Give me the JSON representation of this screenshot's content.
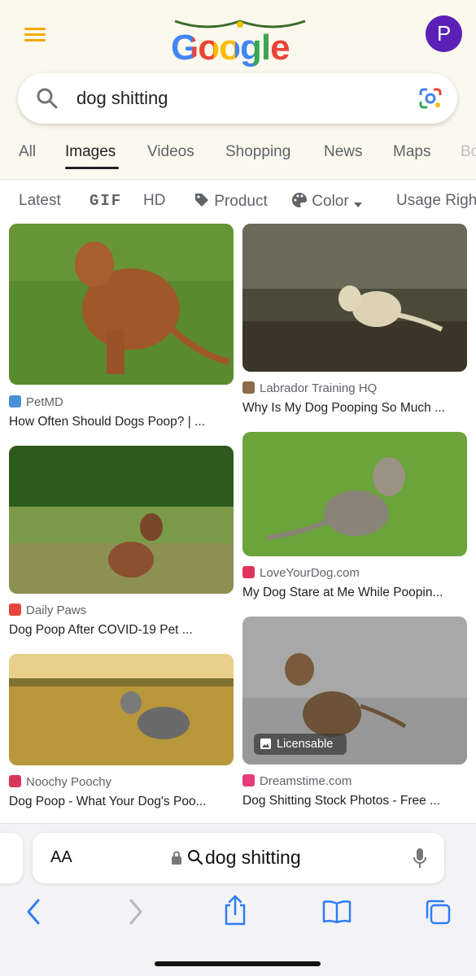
{
  "header": {
    "logo_text": "Google",
    "avatar_letter": "P",
    "colors": {
      "menu": "#f2a900",
      "avatar": "#5b21b6"
    }
  },
  "search": {
    "query": "dog shitting"
  },
  "tabs": [
    {
      "label": "All"
    },
    {
      "label": "Images",
      "active": true
    },
    {
      "label": "Videos"
    },
    {
      "label": "Shopping"
    },
    {
      "label": "News"
    },
    {
      "label": "Maps"
    },
    {
      "label": "Bo"
    }
  ],
  "chips": [
    {
      "label": "Latest"
    },
    {
      "label": "GIF"
    },
    {
      "label": "HD"
    },
    {
      "label": "Product",
      "icon": "tag-icon"
    },
    {
      "label": "Color",
      "icon": "palette-icon"
    },
    {
      "label": "Usage Righ"
    }
  ],
  "results": [
    {
      "source": "PetMD",
      "title": "How Often Should Dogs Poop? | ...",
      "favicon_color": "#4a90d9"
    },
    {
      "source": "Labrador Training HQ",
      "title": "Why Is My Dog Pooping So Much ...",
      "favicon_color": "#8b6b4a"
    },
    {
      "source": "Daily Paws",
      "title": "Dog Poop After COVID-19 Pet ...",
      "favicon_color": "#e8453c"
    },
    {
      "source": "LoveYourDog.com",
      "title": "My Dog Stare at Me While Poopin...",
      "favicon_color": "#e0325a"
    },
    {
      "source": "Noochy Poochy",
      "title": "Dog Poop - What Your Dog's Poo...",
      "favicon_color": "#d9365b"
    },
    {
      "source": "Dreamstime.com",
      "title": "Dog Shitting Stock Photos - Free ...",
      "favicon_color": "#e63c7a",
      "badge": "Licensable"
    }
  ],
  "browser": {
    "text_size_label": "AA",
    "url_text": "dog shitting"
  }
}
